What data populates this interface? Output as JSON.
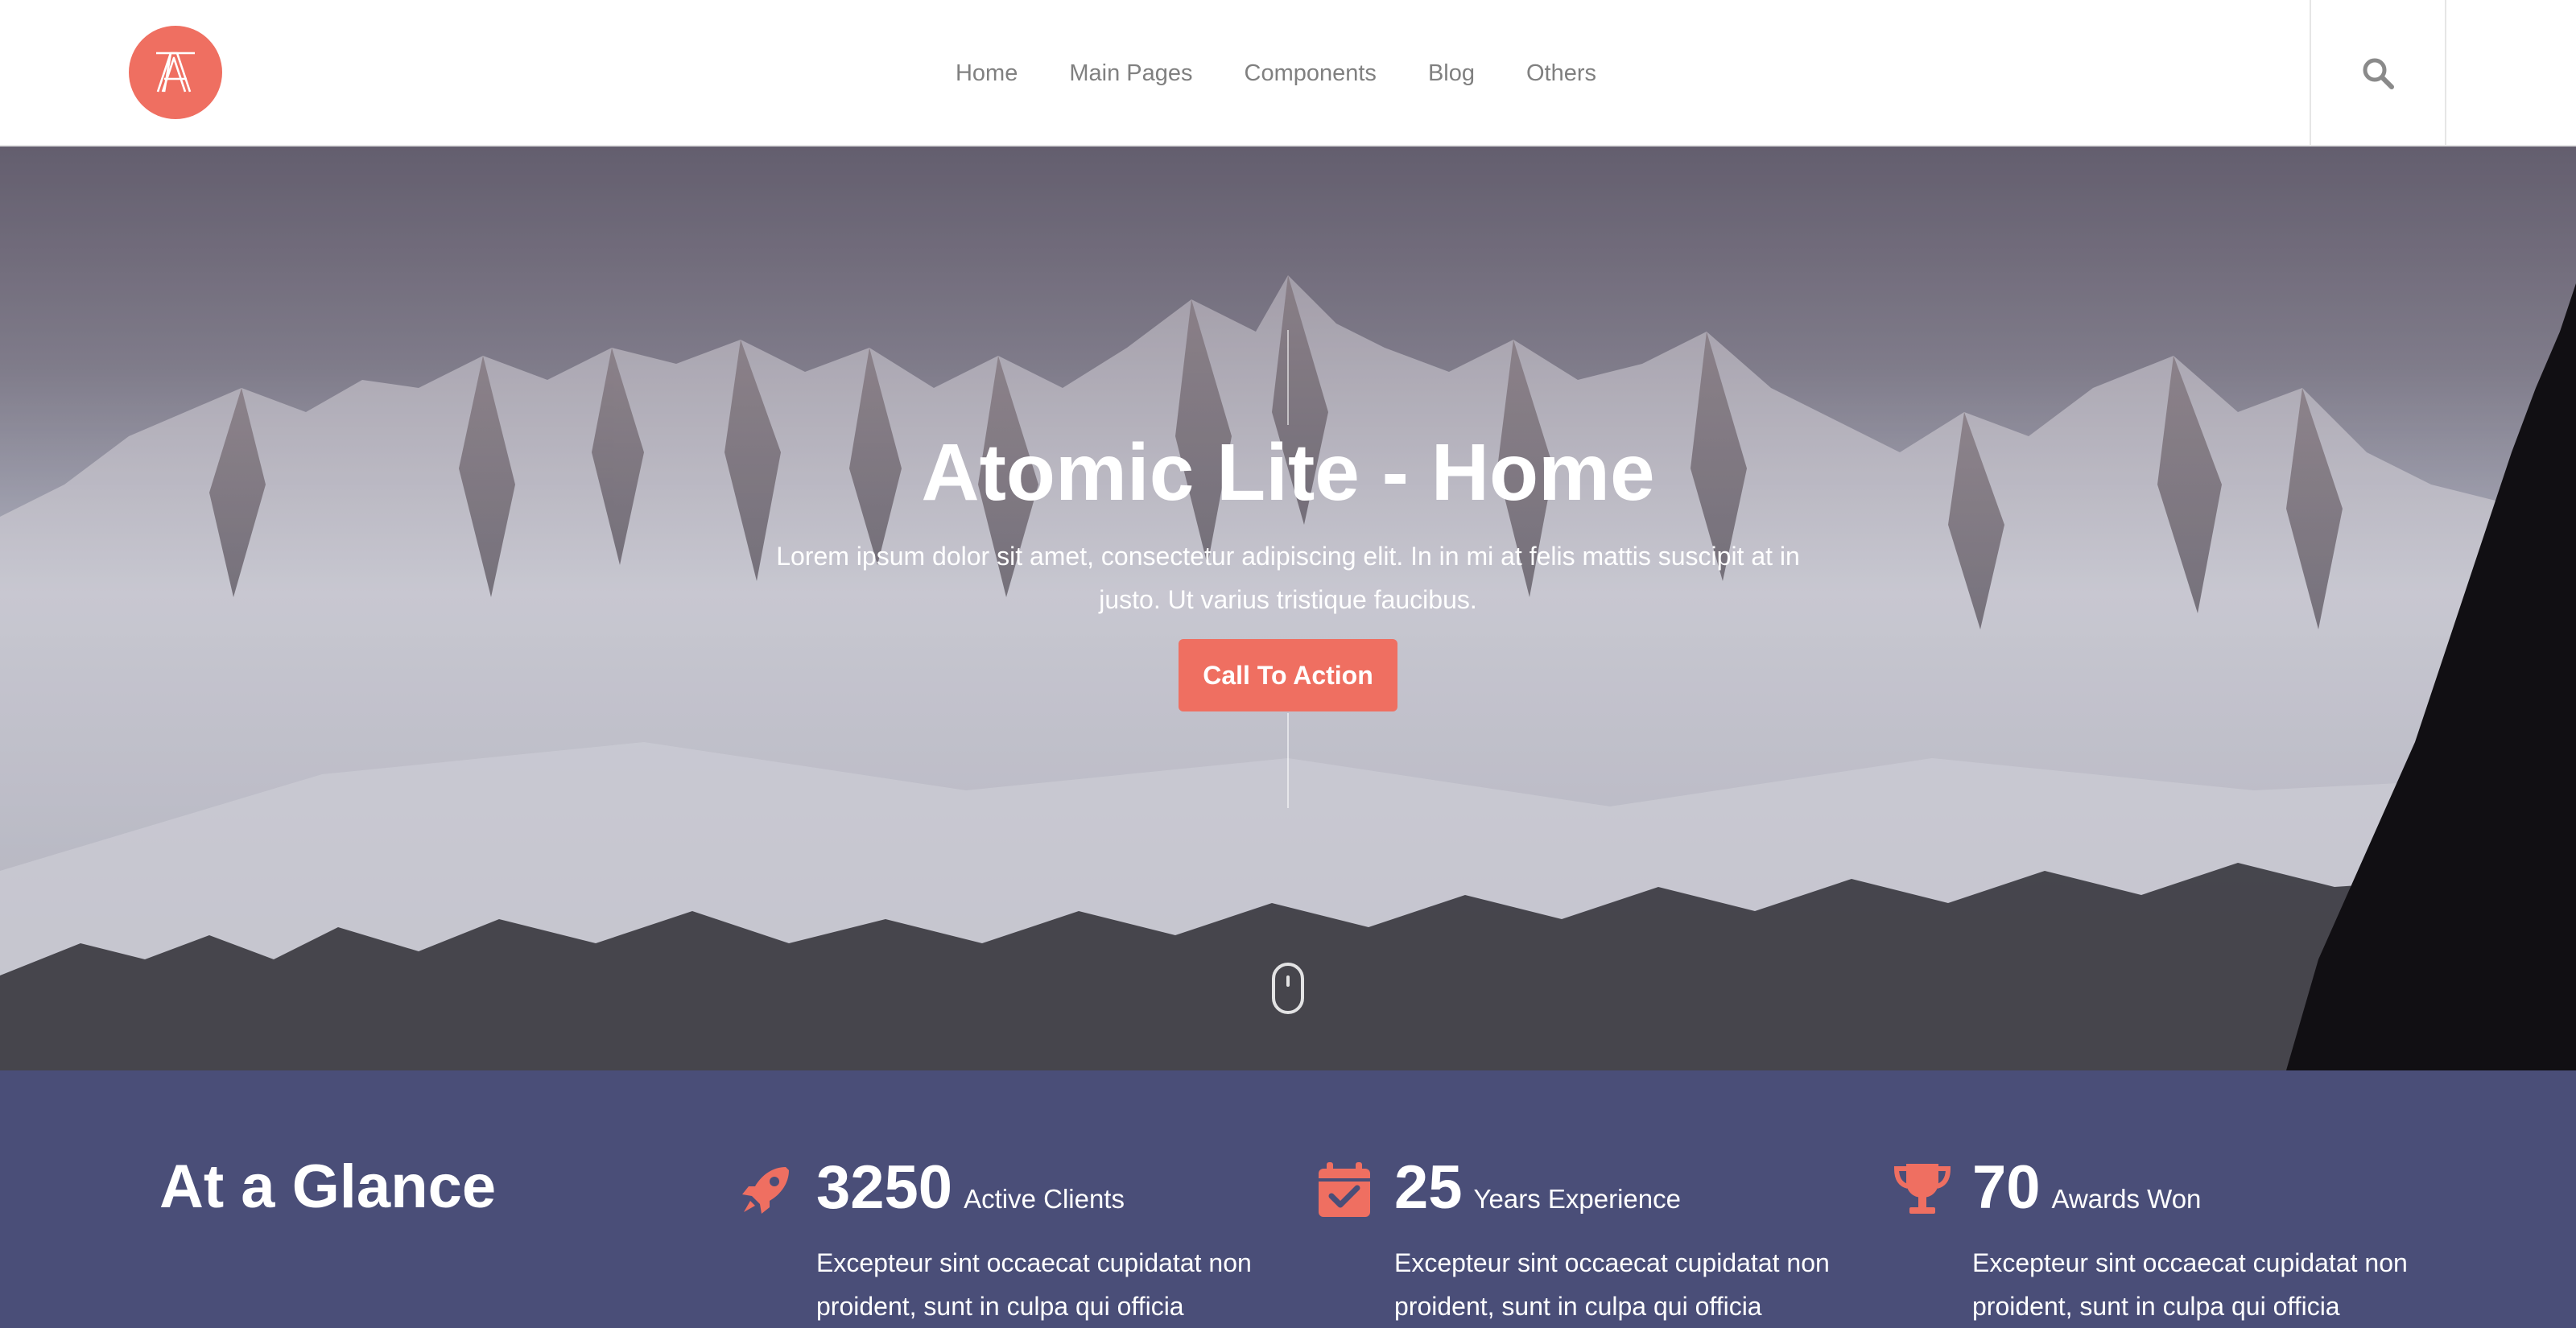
{
  "header": {
    "nav": [
      "Home",
      "Main Pages",
      "Components",
      "Blog",
      "Others"
    ]
  },
  "hero": {
    "title": "Atomic Lite - Home",
    "text": "Lorem ipsum dolor sit amet, consectetur adipiscing elit. In in mi at felis mattis suscipit at in justo. Ut varius tristique faucibus.",
    "cta_label": "Call To Action"
  },
  "stats": {
    "heading": "At a Glance",
    "items": [
      {
        "number": "3250",
        "label": "Active Clients",
        "desc": "Excepteur sint occaecat cupidatat non proident, sunt in culpa qui officia",
        "icon": "rocket-icon"
      },
      {
        "number": "25",
        "label": "Years Experience",
        "desc": "Excepteur sint occaecat cupidatat non proident, sunt in culpa qui officia",
        "icon": "calendar-check-icon"
      },
      {
        "number": "70",
        "label": "Awards Won",
        "desc": "Excepteur sint occaecat cupidatat non proident, sunt in culpa qui officia",
        "icon": "trophy-icon"
      }
    ]
  },
  "colors": {
    "accent": "#ef6f61",
    "stats_bg": "#4a4e78",
    "nav_text": "#808080"
  }
}
